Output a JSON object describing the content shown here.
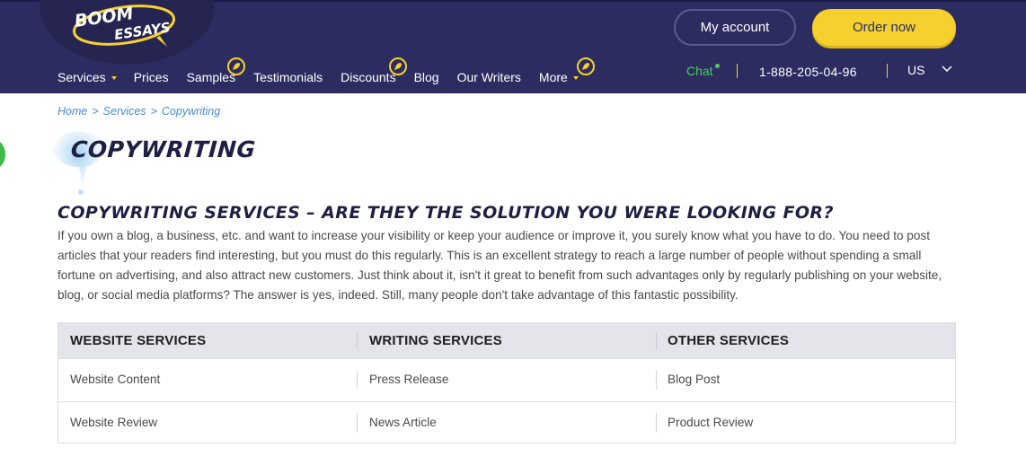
{
  "header": {
    "logo_text": "BOOM ESSAYS",
    "my_account_label": "My account",
    "order_now_label": "Order now",
    "chat_label": "Chat",
    "phone": "1-888-205-04-96",
    "language": "US",
    "nav": [
      {
        "label": "Services"
      },
      {
        "label": "Prices"
      },
      {
        "label": "Samples"
      },
      {
        "label": "Testimonials"
      },
      {
        "label": "Discounts"
      },
      {
        "label": "Blog"
      },
      {
        "label": "Our Writers"
      },
      {
        "label": "More"
      }
    ]
  },
  "breadcrumb": [
    "Home",
    "Services",
    "Copywriting"
  ],
  "breadcrumb_separator": ">",
  "page_title": "COPYWRITING",
  "section_heading": "COPYWRITING SERVICES – ARE THEY THE SOLUTION YOU WERE LOOKING FOR?",
  "intro_paragraph": "If you own a blog, a business, etc. and want to increase your visibility or keep your audience or improve it, you surely know what you have to do. You need to post articles that your readers find interesting, but you must do this regularly. This is an excellent strategy to reach a large number of people without spending a small fortune on advertising, and also attract new customers. Just think about it, isn't it great to benefit from such advantages only by regularly publishing on your website, blog, or social media platforms? The answer is yes, indeed. Still, many people don't take advantage of this fantastic possibility.",
  "services_table": {
    "headers": [
      "WEBSITE SERVICES",
      "WRITING SERVICES",
      "OTHER SERVICES"
    ],
    "rows": [
      [
        "Website Content",
        "Press Release",
        "Blog Post"
      ],
      [
        "Website Review",
        "News Article",
        "Product Review"
      ]
    ]
  },
  "colors": {
    "header_bg": "#2d2c61",
    "accent_yellow": "#f6d12d",
    "chat_green": "#4ccf56",
    "link_blue": "#4a8ad1",
    "heading_navy": "#1f1f44"
  },
  "icons": {
    "nav_badge": "rocket-icon",
    "services_caret": "caret-down-icon",
    "language_chevron": "chevron-down-icon"
  }
}
